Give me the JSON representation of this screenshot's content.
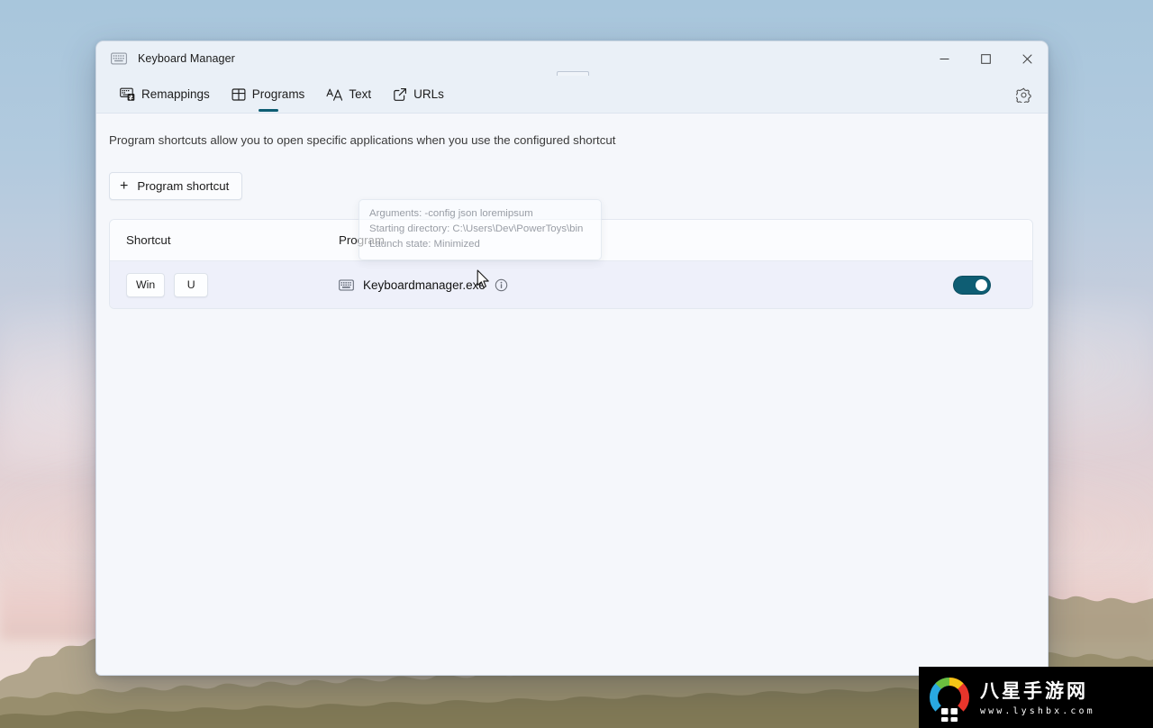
{
  "window": {
    "title": "Keyboard Manager",
    "title_icon": "keyboard-icon",
    "controls": {
      "minimize_label": "─",
      "maximize_label": "□",
      "close_label": "✕"
    }
  },
  "nav": {
    "tabs": [
      {
        "label": "Remappings",
        "icon": "keyboard-remap-icon",
        "active": false
      },
      {
        "label": "Programs",
        "icon": "window-grid-icon",
        "active": true
      },
      {
        "label": "Text",
        "icon": "font-size-icon",
        "active": false
      },
      {
        "label": "URLs",
        "icon": "external-link-icon",
        "active": false
      }
    ],
    "settings_icon": "gear-icon"
  },
  "content": {
    "description": "Program shortcuts allow you to open specific applications when you use the configured shortcut",
    "add_button": {
      "label": "Program shortcut",
      "icon": "plus-icon"
    },
    "table": {
      "columns": [
        "Shortcut",
        "Program"
      ],
      "rows": [
        {
          "keys": [
            "Win",
            "U"
          ],
          "program": "Keyboardmanager.exe",
          "program_icon": "keyboard-icon",
          "info_icon": "info-icon",
          "enabled": true
        }
      ]
    },
    "tooltip": {
      "lines": [
        "Arguments: -config json loremipsum",
        "Starting directory: C:\\Users\\Dev\\PowerToys\\bin",
        "Launch state: Minimized"
      ]
    }
  },
  "colors": {
    "accent": "#0e5d73",
    "window_bg": "#f5f7fb",
    "titlebar_bg": "#eaf0f7",
    "row_bg": "#eef0fa"
  },
  "watermark": {
    "cn_text": "八星手游网",
    "url_text": "www.lyshbx.com"
  }
}
